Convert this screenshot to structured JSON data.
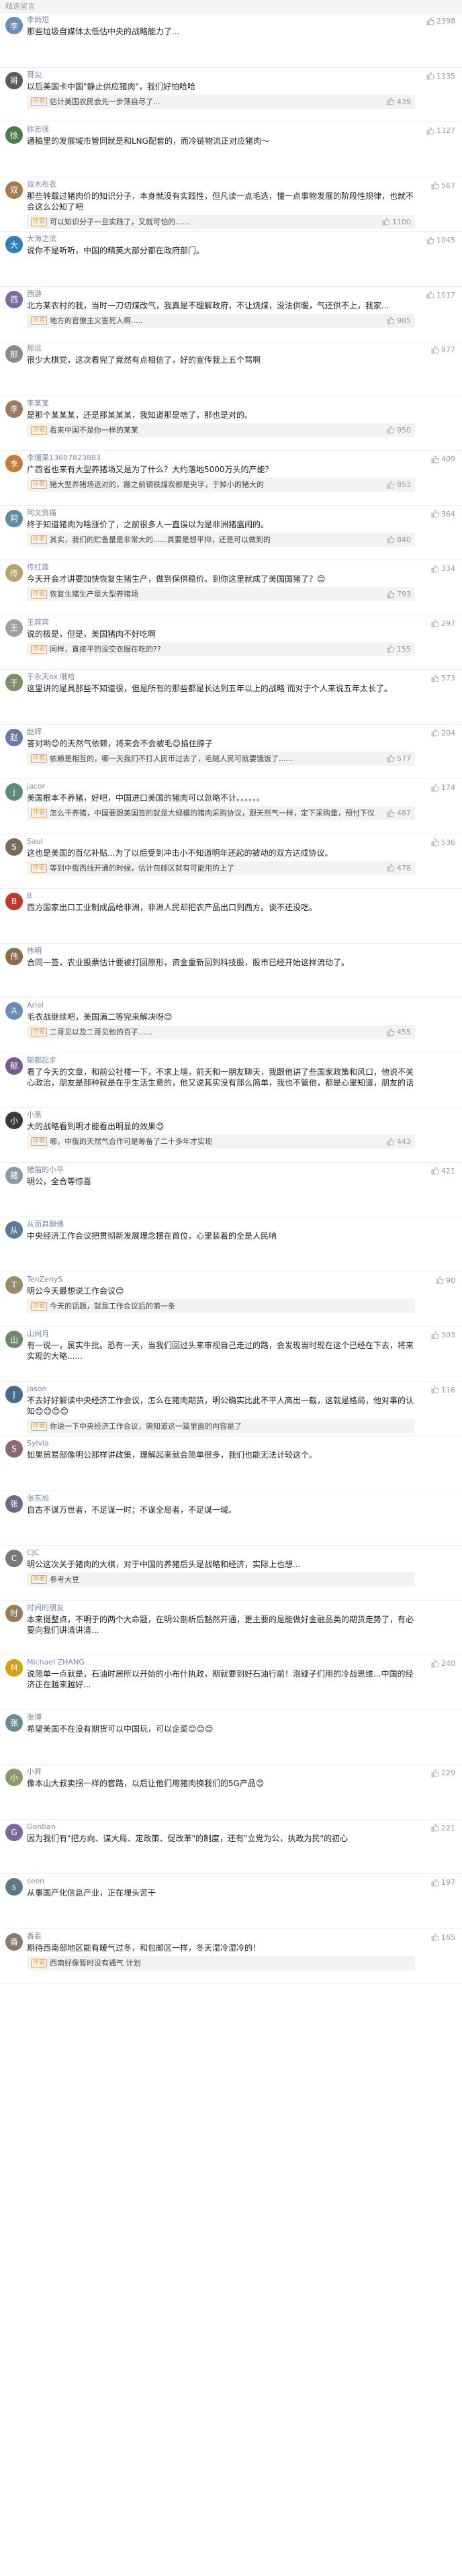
{
  "section_title": "精选留言",
  "author_label": "作者",
  "colors": {
    "accent": "#7a8aa8",
    "badge": "#e8a35a"
  },
  "comments": [
    {
      "user": "李尚烜",
      "likes": "2398",
      "text": "那些垃圾自媒体太低估中央的战略能力了...",
      "reply": "",
      "reply_likes": "",
      "avatar_color": "#6d8fb3"
    },
    {
      "user": "哥尖",
      "likes": "1335",
      "text": "以后美国卡中国\"静止供应猪肉\"，我们好怕哈哈",
      "reply": "估计美国农民会先一步荡自尽了...",
      "reply_likes": "439",
      "avatar_color": "#5b5b5b"
    },
    {
      "user": "徐志强",
      "likes": "1327",
      "text": "通稿里的发展域市管同就是和LNG配套的，而冷链物流正对应猪肉～",
      "reply": "",
      "reply_likes": "",
      "avatar_color": "#4c7a4c"
    },
    {
      "user": "双木布衣",
      "likes": "567",
      "text": "那些转载过猪肉价的知识分子，本身就没有实践性，但凡读一点毛选，懂一点事物发展的阶段性规律，也就不会这么公知了吧",
      "reply": "可以知识分子一旦实践了，又就可怕的......",
      "reply_likes": "1100",
      "avatar_color": "#a57b4e"
    },
    {
      "user": "大海之滨",
      "likes": "1045",
      "text": "说你不是听听，中国的精英大部分都在政府部门。",
      "reply": "",
      "reply_likes": "",
      "avatar_color": "#2f7eb8"
    },
    {
      "user": "西游",
      "likes": "1017",
      "text": "北方某农村的我，当时一刀切煤改气，我真是不理解政府，不让烧煤，没法供暖，气还供不上，我家...",
      "reply": "地方的官僚主义害死人啊.....",
      "reply_likes": "985",
      "avatar_color": "#7b6a9b"
    },
    {
      "user": "那远",
      "likes": "977",
      "text": "很少大棋党，这次看完了竟然有点相信了，好的宣传我上五个骂啊",
      "reply": "",
      "reply_likes": "",
      "avatar_color": "#8a8a8a"
    },
    {
      "user": "李某某",
      "likes": "",
      "text": "是那个某某某，还是那某某某，我知道那是啥了，那也是对的。",
      "reply": "看来中国不是你一样的某某",
      "reply_likes": "950",
      "avatar_color": "#9b7a5e"
    },
    {
      "user": "李珊果13607823883",
      "likes": "409",
      "text": "广西省也来有大型养猪场又是为了什么？大约落地5000万头的产能？",
      "reply": "猪大型养猪场选对的，搬之前钢铁煤炭都是央字，于掉小的猪大的",
      "reply_likes": "853",
      "avatar_color": "#c47a3a"
    },
    {
      "user": "阿文资痛",
      "likes": "364",
      "text": "终于知道猪肉为啥涨价了，之前很多人一直误以为是非洲猪瘟闹的。",
      "reply": "其实，我们的贮备量是非常大的......真要是想平抑，还是可以做到的",
      "reply_likes": "840",
      "avatar_color": "#5a8f9b"
    },
    {
      "user": "传红霖",
      "likes": "334",
      "text": "今天开会才讲要加快恢复生猪生产，做到保供稳价。到你这里就成了美国国猪了？😊",
      "reply": "恢复生猪生产是大型养猪场",
      "reply_likes": "793",
      "avatar_color": "#b8a070"
    },
    {
      "user": "王宾宾",
      "likes": "297",
      "text": "说的极是，但是，美国猪肉不好吃啊",
      "reply": "同样，直接平的没交衣服在吃的??",
      "reply_likes": "155",
      "avatar_color": "#a0a0a0"
    },
    {
      "user": "于永天ox 哦哈",
      "likes": "573",
      "text": "这里讲的是具那些不知道很，但是所有的那些都是长达到五年以上的战略 而对于个人来说五年太长了。",
      "reply": "",
      "reply_likes": "",
      "avatar_color": "#7e8c6a"
    },
    {
      "user": "赵辉",
      "likes": "204",
      "text": "答对哟😊的天然气依赖，将来会不会被毛😊掐住脖子",
      "reply": "依赖是相互的，哪一天我们不打人民币过去了，毛贼人民可就要饿饭了......",
      "reply_likes": "577",
      "avatar_color": "#6a7aa8"
    },
    {
      "user": "jacor",
      "likes": "174",
      "text": "美国根本不养猪，好吧，中国进口美国的猪肉可以忽略不计。。。。。。",
      "reply": "怎么干养猪，中国要跟美国签的就是大规模的猪肉采购协议，跟天然气一样，定下采购量，预付下仪",
      "reply_likes": "487",
      "avatar_color": "#5f8a7c"
    },
    {
      "user": "Saul",
      "likes": "536",
      "text": "这也是美国的百亿补贴...为了以后受到冲击小不知道明年还起的被动的双方达成协议。",
      "reply": "等到中俄西线开通的时候，估计包邮区就有可能用的上了",
      "reply_likes": "478",
      "avatar_color": "#7a6a5a"
    },
    {
      "user": "B",
      "likes": "",
      "text": "西方国家出口工业制成品给非洲，非洲人民却把农产品出口到西方。谈不还没吃。",
      "reply": "",
      "reply_likes": "",
      "avatar_color": "#c0392b"
    },
    {
      "user": "伟明",
      "likes": "",
      "text": "合同一签，农业股票估计要被打回原形，资金重新回到科技股，股市已经开始这样流动了。",
      "reply": "",
      "reply_likes": "",
      "avatar_color": "#8b6b4b"
    },
    {
      "user": "Ariel",
      "likes": "",
      "text": "毛衣战继续吧，美国满二等完来解决呀😊",
      "reply": "二哥见以及二哥见他的百子......",
      "reply_likes": "455",
      "avatar_color": "#6a8ab8"
    },
    {
      "user": "郁都起步",
      "likes": "",
      "text": "看了今天的文章，和前公社楼一下，不求上墙，前天和一朋友聊天，我跟他讲了些国家政策和风口，他说不关心政治，朋友是那种就是在乎生活生意的，他又说其实没有那么简单，我也不管他，都是心里知道，朋友的话完全正确，他又说我们没过过苦日子，他讲的那些也不对啊...",
      "reply": "",
      "reply_likes": "",
      "avatar_color": "#7a5a8a"
    },
    {
      "user": "小黑",
      "likes": "",
      "text": "大的战略看到明才能看出明显的效果😊",
      "reply": "哪，中俄的天然气合作可是筹备了二十多年才实现",
      "reply_likes": "443",
      "avatar_color": "#3a3a3a"
    },
    {
      "user": "猪猫的小平",
      "likes": "421",
      "text": "明公，全合等惊喜",
      "reply": "",
      "reply_likes": "",
      "avatar_color": "#8a9aaa"
    },
    {
      "user": "从而真飘佛",
      "likes": "",
      "text": "中央经济工作会议把贯彻新发展理念摆在首位，心里装着的全是人民呐",
      "reply": "",
      "reply_likes": "",
      "avatar_color": "#5a7a9a"
    },
    {
      "user": "TenZenyS",
      "likes": "90",
      "text": "明公今天最想说工作会议😊",
      "reply": "今天的话题，就是工作会议后的第一条",
      "reply_likes": "",
      "avatar_color": "#9a8a6a"
    },
    {
      "user": "山间月",
      "likes": "303",
      "text": "有一说一，属实牛批。恐有一天，当我们回过头来审视自己走过的路，会发现当时现在这个已经在下去，将来实现的大略......",
      "reply": "",
      "reply_likes": "",
      "avatar_color": "#6a8a6a"
    },
    {
      "user": "Jason",
      "likes": "116",
      "text": "不去好好解读中央经济工作会议，怎么在猪肉期货，明公确实比此不平人高出一截，这就是格局，他对事的认知😊😊😊😊",
      "reply": "你说一下中央经济工作会议，需知道这一篇里面的内容是了",
      "reply_likes": "",
      "avatar_color": "#4a6a8a"
    },
    {
      "user": "Sylvia",
      "likes": "",
      "text": "如果贸易部像明公那样讲政策，理解起来就会简单很多，我们也能无法计较这个。",
      "reply": "",
      "reply_likes": "",
      "avatar_color": "#8a6a7a"
    },
    {
      "user": "张东旭",
      "likes": "",
      "text": "自古不谋万世者，不足谋一时；不谋全局者，不足谋一域。",
      "reply": "",
      "reply_likes": "",
      "avatar_color": "#6a6a8a"
    },
    {
      "user": "CJC",
      "likes": "",
      "text": "明公这次关于猪肉的大棋，对于中国的养猪后头是战略和经济，实际上也想...",
      "reply": "参考大豆",
      "reply_likes": "",
      "avatar_color": "#7a7a7a"
    },
    {
      "user": "时间的朋友",
      "likes": "",
      "text": "本来挺整点，不明于的两个大命题，在明公剖析后豁然开通，更主要的是能做好金融品类的期货走势了，有必要向我们讲清讲清...",
      "reply": "",
      "reply_likes": "",
      "avatar_color": "#9a7a5a"
    },
    {
      "user": "Michael ZHANG",
      "likes": "240",
      "text": "说简单一点就是，石油时居所以开始的小布什执政，期就要到好石油行前！泡疑子们用的冷战思维...中国的经济正在越来越好...",
      "reply": "",
      "reply_likes": "",
      "avatar_color": "#d4a017"
    },
    {
      "user": "张博",
      "likes": "",
      "text": "希望美国不在没有期货可以中国玩，可以企菜😊😊😊",
      "reply": "",
      "reply_likes": "",
      "avatar_color": "#6a8a9a"
    },
    {
      "user": "小昇",
      "likes": "229",
      "text": "像本山大叔卖拐一样的套路，以后让他们用猪肉换我们的5G产品😊",
      "reply": "",
      "reply_likes": "",
      "avatar_color": "#8a9a6a"
    },
    {
      "user": "Gonban",
      "likes": "221",
      "text": "因为我们有\"把方向、谋大局、定政策、促改革\"的制度，还有\"立党为公，执政为民\"的初心",
      "reply": "",
      "reply_likes": "",
      "avatar_color": "#7a6a9a"
    },
    {
      "user": "seen",
      "likes": "197",
      "text": "从事国产化信息产业，正在埋头苦干",
      "reply": "",
      "reply_likes": "",
      "avatar_color": "#5a7a8a"
    },
    {
      "user": "香看",
      "likes": "165",
      "text": "期待西南部地区能有暖气过冬，和包邮区一样，冬天湿冷湿冷的！",
      "reply": "西南好像暂时没有通气 计划",
      "reply_likes": "",
      "avatar_color": "#8a7a6a"
    }
  ]
}
